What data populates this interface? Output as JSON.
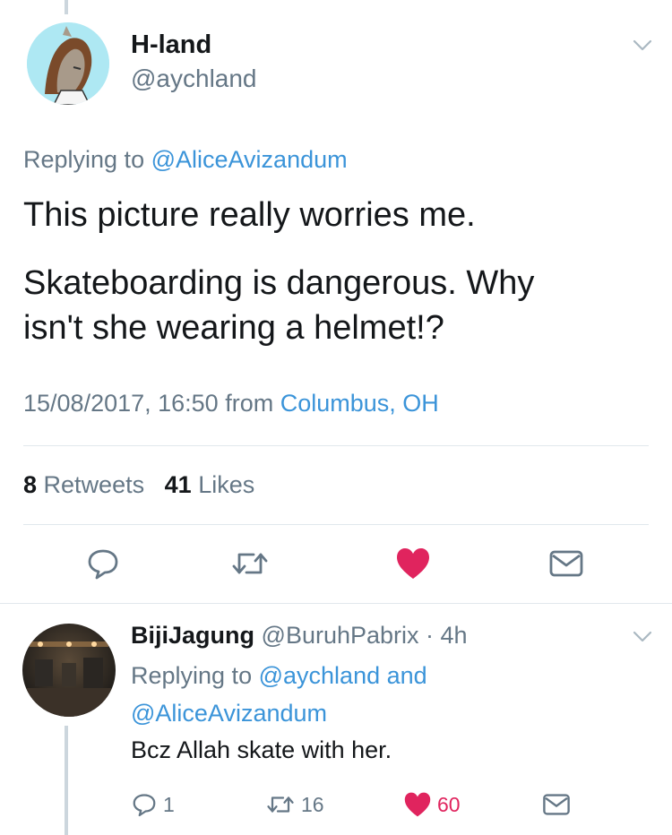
{
  "main_tweet": {
    "display_name": "H-land",
    "handle": "@aychland",
    "replying_prefix": "Replying to",
    "replying_to": "@AliceAvizandum",
    "text_line1": "This picture really worries me.",
    "text_line2": "Skateboarding is dangerous. Why",
    "text_line3": "isn't she wearing a helmet!?",
    "timestamp": "15/08/2017, 16:50 from",
    "location": "Columbus, OH",
    "retweets_count": "8",
    "retweets_label": "Retweets",
    "likes_count": "41",
    "likes_label": "Likes"
  },
  "reply_tweet": {
    "display_name": "BijiJagung",
    "handle_time": "@BuruhPabrix · 4h",
    "replying_prefix": "Replying to",
    "replying_to_1": "@aychland",
    "replying_and": "and",
    "replying_to_2": "@AliceAvizandum",
    "text": "Bcz Allah skate with her.",
    "reply_count": "1",
    "retweet_count": "16",
    "like_count": "60"
  },
  "icons": {
    "reply": "reply-icon",
    "retweet": "retweet-icon",
    "like": "heart-icon",
    "message": "envelope-icon",
    "more": "chevron-down-icon"
  },
  "colors": {
    "link": "#3b94d9",
    "like": "#e0245e",
    "secondary_text": "#657786",
    "icon_gray": "#657786",
    "thread_line": "#ccd6dd"
  }
}
